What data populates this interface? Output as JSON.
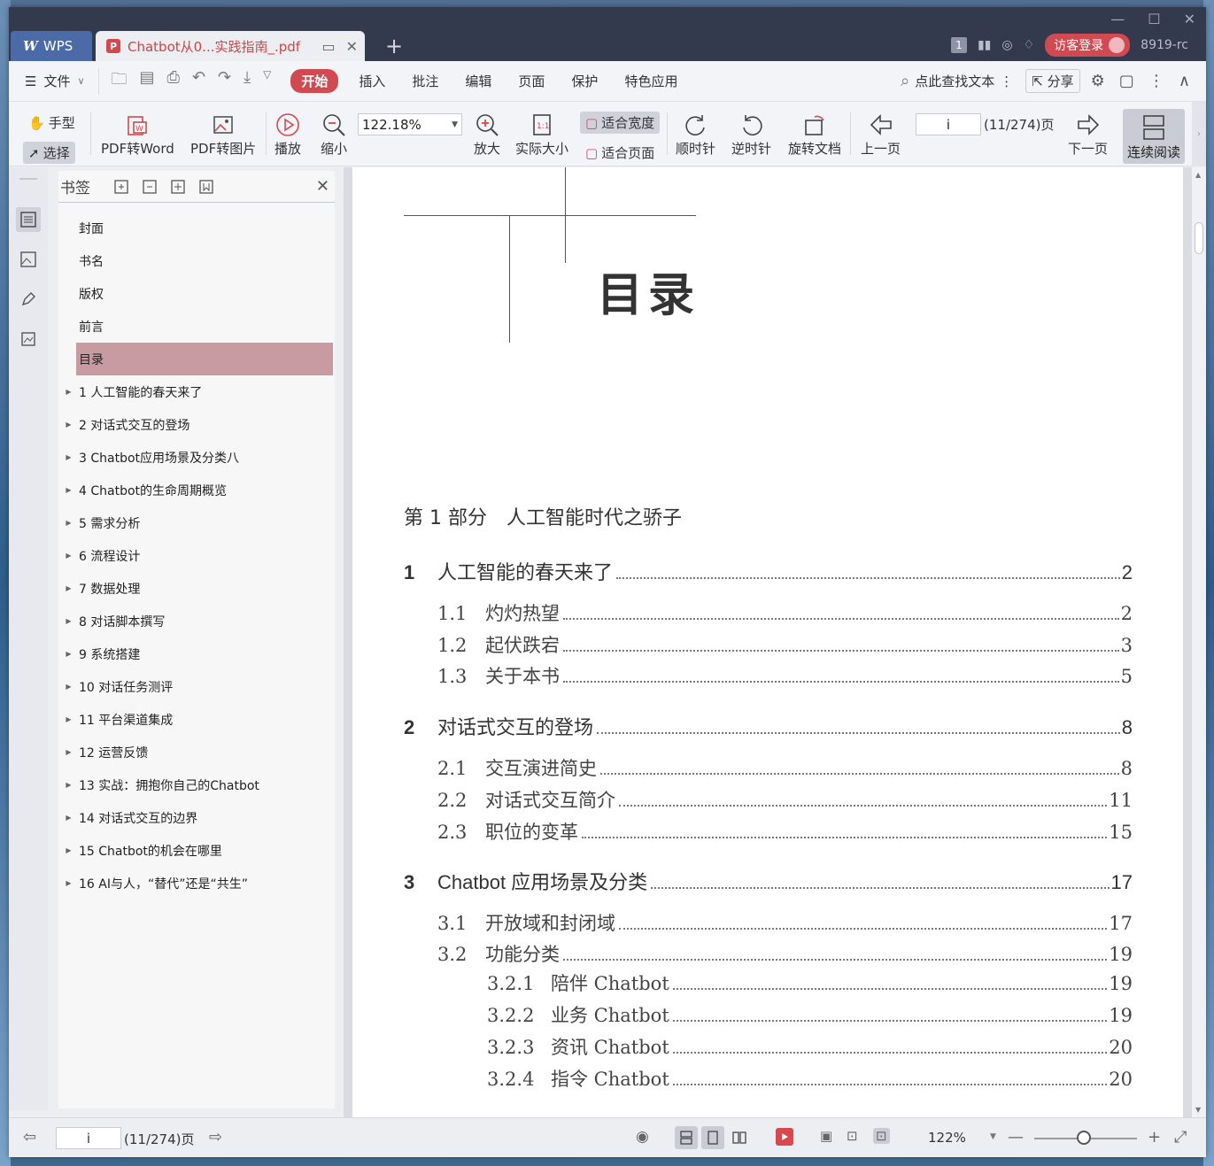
{
  "titlebar": {
    "app_name": "WPS",
    "doc_tab_title": "Chatbot从0...实践指南_.pdf",
    "badge_count": "1",
    "login_label": "访客登录",
    "user_id": "8919-rc"
  },
  "menubar": {
    "file": "文件",
    "tabs": [
      "开始",
      "插入",
      "批注",
      "编辑",
      "页面",
      "保护",
      "特色应用"
    ],
    "search": "点此查找文本",
    "share": "分享"
  },
  "toolbar": {
    "hand": "手型",
    "select": "选择",
    "pdf_to_word": "PDF转Word",
    "pdf_to_image": "PDF转图片",
    "play": "播放",
    "zoom_out": "缩小",
    "zoom_value": "122.18%",
    "zoom_in": "放大",
    "actual_size": "实际大小",
    "fit_width": "适合宽度",
    "fit_page": "适合页面",
    "clockwise": "顺时针",
    "counter_clockwise": "逆时针",
    "rotate_doc": "旋转文档",
    "prev_page": "上一页",
    "page_input": "i",
    "page_total": "(11/274)页",
    "next_page": "下一页",
    "continuous": "连续阅读"
  },
  "bookmarks": {
    "title": "书签",
    "items": [
      {
        "label": "封面",
        "has_children": false,
        "selected": false
      },
      {
        "label": "书名",
        "has_children": false,
        "selected": false
      },
      {
        "label": "版权",
        "has_children": false,
        "selected": false
      },
      {
        "label": "前言",
        "has_children": false,
        "selected": false
      },
      {
        "label": "目录",
        "has_children": false,
        "selected": true
      },
      {
        "label": "1 人工智能的春天来了",
        "has_children": true,
        "selected": false
      },
      {
        "label": "2 对话式交互的登场",
        "has_children": true,
        "selected": false
      },
      {
        "label": "3 Chatbot应用场景及分类八",
        "has_children": true,
        "selected": false
      },
      {
        "label": "4 Chatbot的生命周期概览",
        "has_children": true,
        "selected": false
      },
      {
        "label": "5 需求分析",
        "has_children": true,
        "selected": false
      },
      {
        "label": "6 流程设计",
        "has_children": true,
        "selected": false
      },
      {
        "label": "7 数据处理",
        "has_children": true,
        "selected": false
      },
      {
        "label": "8 对话脚本撰写",
        "has_children": true,
        "selected": false
      },
      {
        "label": "9 系统搭建",
        "has_children": true,
        "selected": false
      },
      {
        "label": "10 对话任务测评",
        "has_children": true,
        "selected": false
      },
      {
        "label": "11 平台渠道集成",
        "has_children": true,
        "selected": false
      },
      {
        "label": "12 运营反馈",
        "has_children": true,
        "selected": false
      },
      {
        "label": "13 实战：拥抱你自己的Chatbot",
        "has_children": true,
        "selected": false
      },
      {
        "label": "14 对话式交互的边界",
        "has_children": true,
        "selected": false
      },
      {
        "label": "15 Chatbot的机会在哪里",
        "has_children": true,
        "selected": false
      },
      {
        "label": "16 AI与人，“替代”还是“共生”",
        "has_children": true,
        "selected": false
      }
    ]
  },
  "document": {
    "toc_title": "目录",
    "part": "第 1 部分　人工智能时代之骄子",
    "entries": [
      {
        "level": "ch",
        "num": "1",
        "title": "人工智能的春天来了",
        "page": "2"
      },
      {
        "level": "sec",
        "num": "1.1",
        "title": "灼灼热望",
        "page": "2"
      },
      {
        "level": "sec",
        "num": "1.2",
        "title": "起伏跌宕",
        "page": "3"
      },
      {
        "level": "sec",
        "num": "1.3",
        "title": "关于本书",
        "page": "5"
      },
      {
        "level": "ch",
        "num": "2",
        "title": "对话式交互的登场",
        "page": "8"
      },
      {
        "level": "sec",
        "num": "2.1",
        "title": "交互演进简史",
        "page": "8"
      },
      {
        "level": "sec",
        "num": "2.2",
        "title": "对话式交互简介",
        "page": "11"
      },
      {
        "level": "sec",
        "num": "2.3",
        "title": "职位的变革",
        "page": "15"
      },
      {
        "level": "ch",
        "num": "3",
        "title": "Chatbot 应用场景及分类",
        "page": "17"
      },
      {
        "level": "sec",
        "num": "3.1",
        "title": "开放域和封闭域",
        "page": "17"
      },
      {
        "level": "sec",
        "num": "3.2",
        "title": "功能分类",
        "page": "19"
      },
      {
        "level": "sub",
        "num": "3.2.1",
        "title": "陪伴 Chatbot",
        "page": "19"
      },
      {
        "level": "sub",
        "num": "3.2.2",
        "title": "业务 Chatbot",
        "page": "19"
      },
      {
        "level": "sub",
        "num": "3.2.3",
        "title": "资讯 Chatbot",
        "page": "20"
      },
      {
        "level": "sub",
        "num": "3.2.4",
        "title": "指令 Chatbot",
        "page": "20"
      }
    ]
  },
  "statusbar": {
    "page_input": "i",
    "page_total": "(11/274)页",
    "zoom": "122%"
  },
  "colors": {
    "accent": "#d14a52",
    "titlebar": "#343a4e",
    "bookmark_selected": "#c89aa1"
  }
}
